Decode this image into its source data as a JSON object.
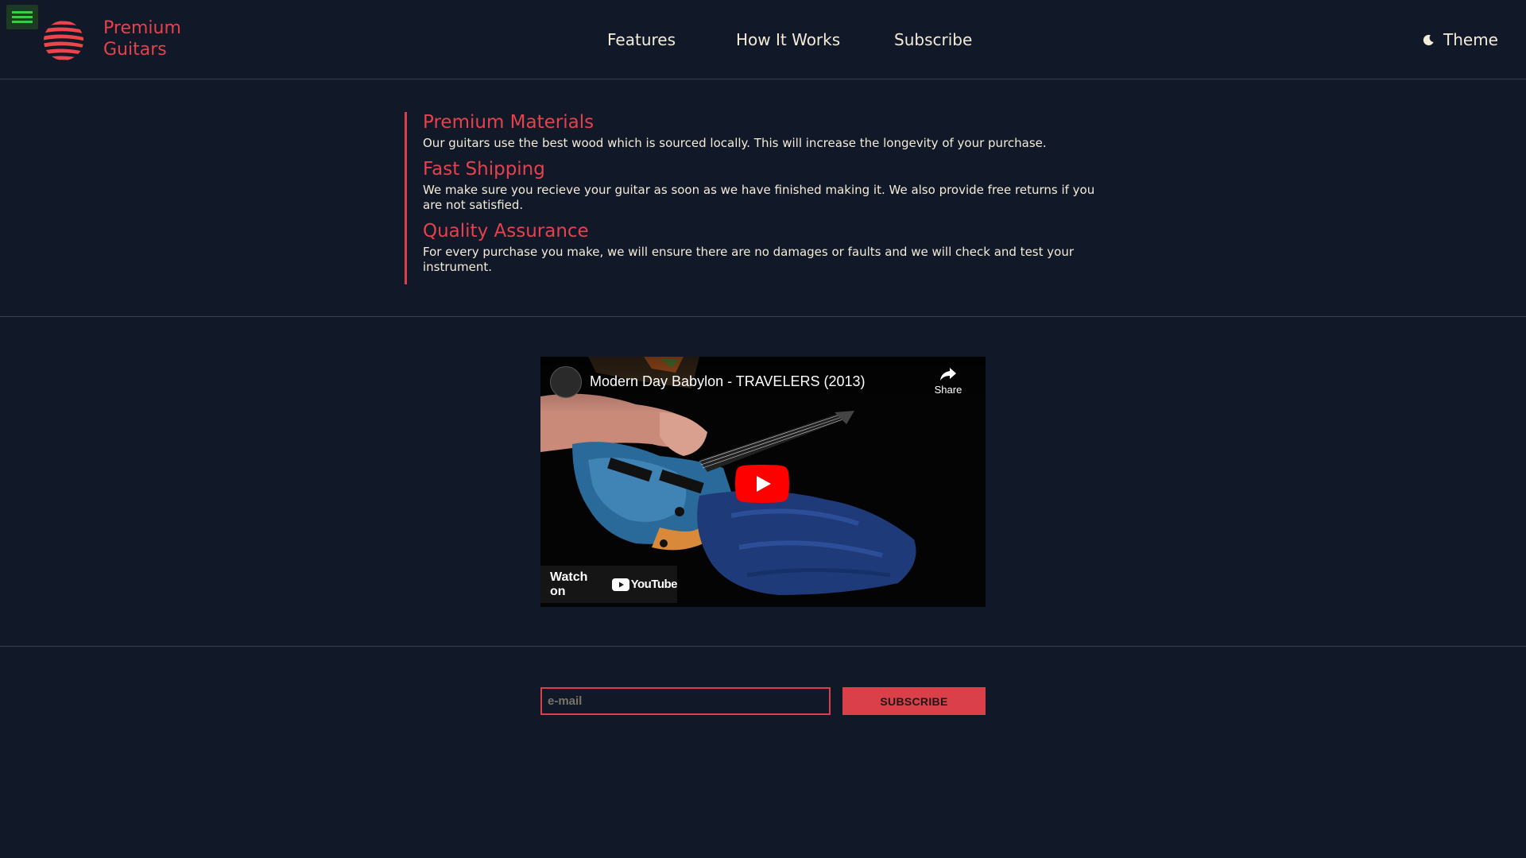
{
  "header": {
    "menu_icon": "hamburger-menu-icon",
    "logo_icon": "striped-sphere-logo-icon",
    "brand_line1": "Premium",
    "brand_line2": "Guitars",
    "nav": [
      "Features",
      "How It Works",
      "Subscribe"
    ],
    "theme_icon": "moon-icon",
    "theme_label": "Theme"
  },
  "features": [
    {
      "title": "Premium Materials",
      "text": "Our guitars use the best wood which is sourced locally. This will increase the longevity of your purchase."
    },
    {
      "title": "Fast Shipping",
      "text": "We make sure you recieve your guitar as soon as we have finished making it. We also provide free returns if you are not satisfied."
    },
    {
      "title": "Quality Assurance",
      "text": "For every purchase you make, we will ensure there are no damages or faults and we will check and test your instrument."
    }
  ],
  "video": {
    "title": "Modern Day Babylon - TRAVELERS (2013)",
    "share_label": "Share",
    "watch_on_label": "Watch on",
    "youtube_label": "YouTube",
    "play_icon": "play-icon",
    "share_icon": "share-arrow-icon"
  },
  "subscribe": {
    "email_placeholder": "e-mail",
    "button_label": "SUBSCRIBE"
  },
  "colors": {
    "background": "#111827",
    "accent": "#d94049",
    "text": "#f3ecd8",
    "menu_green": "#3ccb49"
  }
}
